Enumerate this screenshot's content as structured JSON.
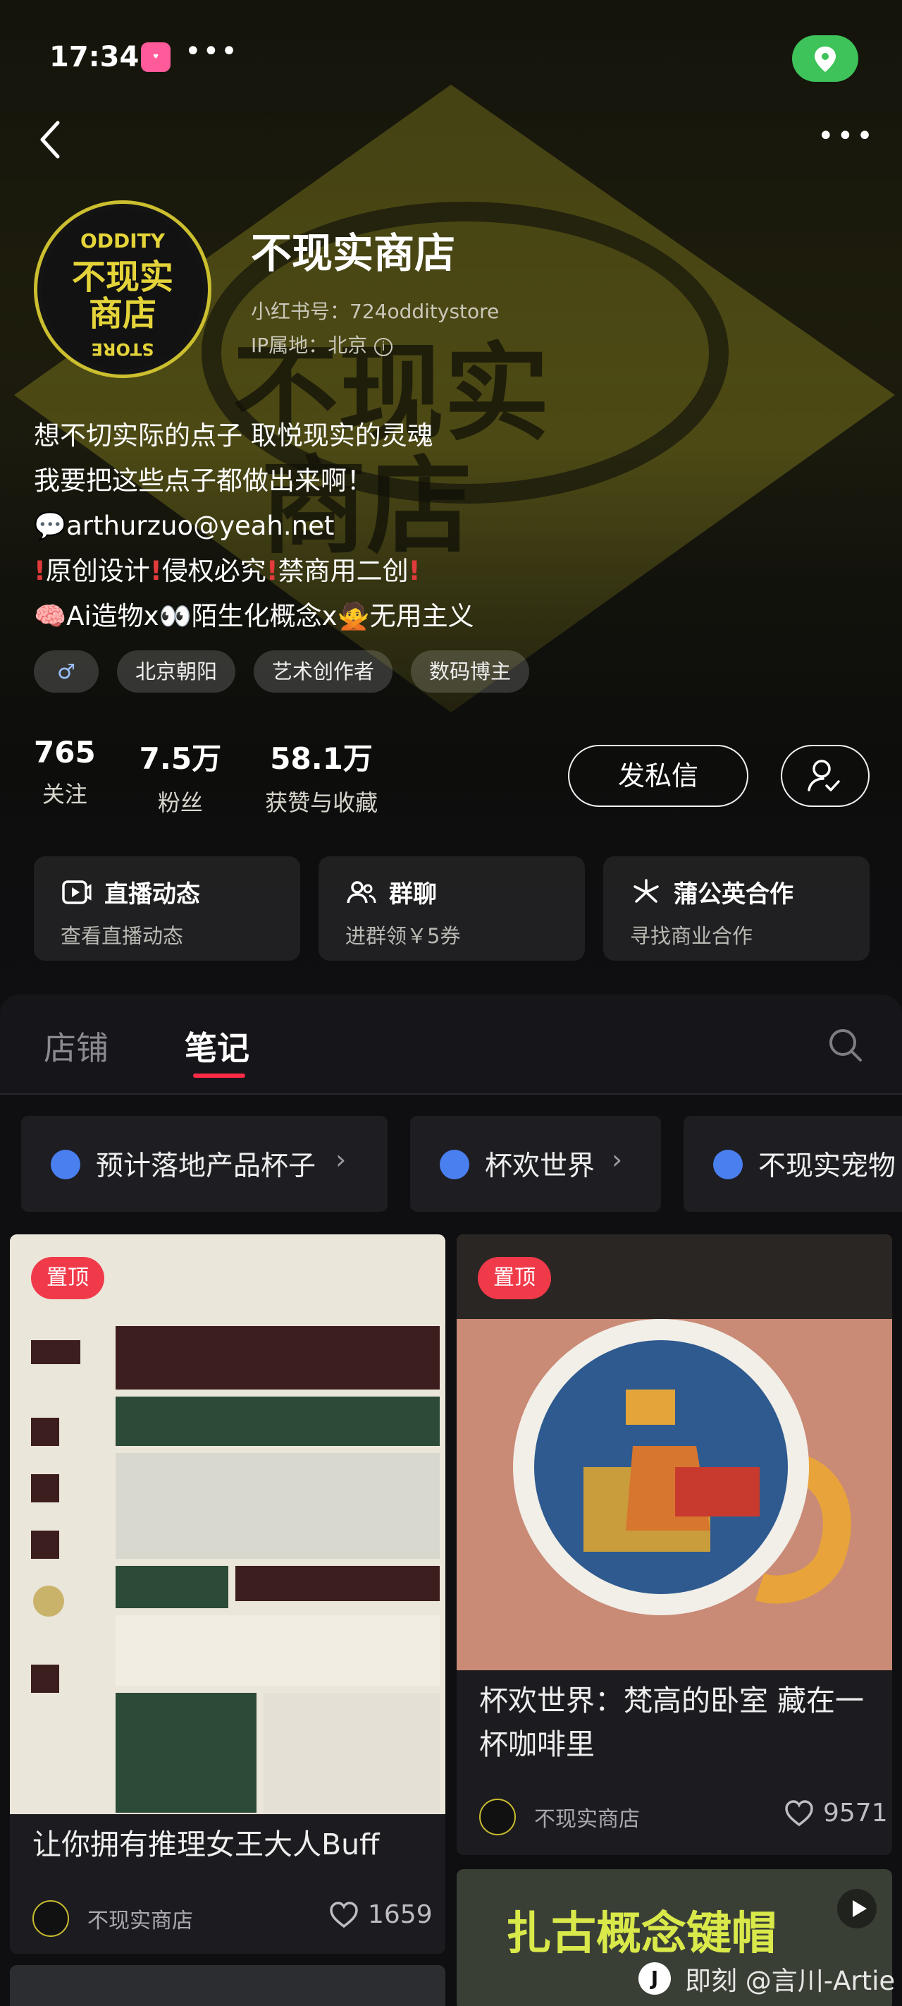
{
  "status_bar": {
    "time": "17:34",
    "overflow": "•••"
  },
  "header": {
    "more": "•••"
  },
  "profile": {
    "name": "不现实商店",
    "rednote_id": "小红书号：724odditystore",
    "ip": "IP属地：北京",
    "logo_lines": [
      "ODDITY",
      "不现实",
      "商店",
      "STORE"
    ],
    "bio": {
      "line1": "想不切实际的点子 取悦现实的灵魂",
      "line2": "我要把这些点子都做出来啊！",
      "line3_icon": "💬",
      "line3": "arthurzuo@yeah.net",
      "line4_parts": [
        "原创设计",
        "侵权必究",
        "禁商用二创"
      ],
      "line5": "🧠Ai造物x👀陌生化概念x🙅无用主义"
    },
    "tags": [
      "♂",
      "北京朝阳",
      "艺术创作者",
      "数码博主"
    ],
    "stats": [
      {
        "num": "765",
        "label": "关注"
      },
      {
        "num": "7.5万",
        "label": "粉丝"
      },
      {
        "num": "58.1万",
        "label": "获赞与收藏"
      }
    ],
    "message_button": "发私信"
  },
  "feature_cards": [
    {
      "icon": "live-icon",
      "title": "直播动态",
      "sub": "查看直播动态"
    },
    {
      "icon": "group-chat-icon",
      "title": "群聊",
      "sub": "进群领￥5券"
    },
    {
      "icon": "dandelion-icon",
      "title": "蒲公英合作",
      "sub": "寻找商业合作"
    }
  ],
  "tabs": {
    "shop": "店铺",
    "notes": "笔记"
  },
  "collections": [
    {
      "label": "预计落地产品杯子"
    },
    {
      "label": "杯欢世界"
    },
    {
      "label": "不现实宠物"
    }
  ],
  "notes": [
    {
      "pin": "置顶",
      "title": "让你拥有推理女王大人Buff",
      "author": "不现实商店",
      "likes": "1659"
    },
    {
      "pin": "置顶",
      "title": "杯欢世界：梵高的卧室 藏在一杯咖啡里",
      "author": "不现实商店",
      "likes": "9571"
    },
    {
      "title_overlay": "扎古概念键帽"
    }
  ],
  "watermark": "即刻 @言川-Artie",
  "colors": {
    "accent_red": "#ff2a46",
    "brand_yellow": "#e4d43a",
    "location_green": "#3ec35a"
  }
}
